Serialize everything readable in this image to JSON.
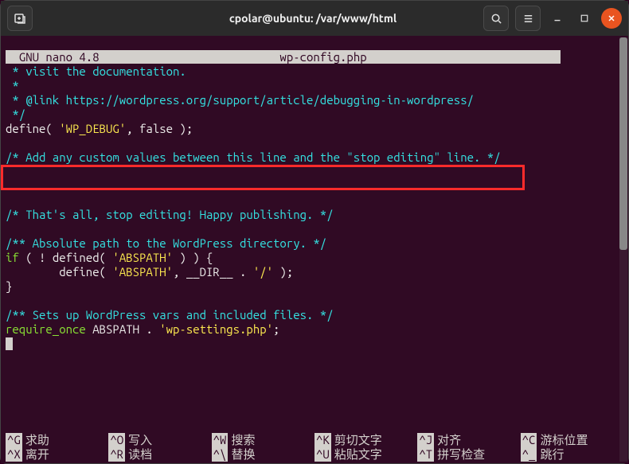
{
  "titlebar": {
    "title": "cpolar@ubuntu: /var/www/html"
  },
  "editor": {
    "header_left": "  GNU nano 4.8",
    "header_center": "wp-config.php",
    "lines": {
      "l1": " * visit the documentation.",
      "l2": " *",
      "l3": " * @link https://wordpress.org/support/article/debugging-in-wordpress/",
      "l4": " */",
      "l5a": "define( ",
      "l5b": "'WP_DEBUG'",
      "l5c": ", false );",
      "l6": "/* Add any custom values between this line and the \"stop editing\" line. */",
      "l7": "/* That's all, stop editing! Happy publishing. */",
      "l8": "/** Absolute path to the WordPress directory. */",
      "l9a": "if",
      "l9b": " ( ! defined( ",
      "l9c": "'ABSPATH'",
      "l9d": " ) ) {",
      "l10a": "        define( ",
      "l10b": "'ABSPATH'",
      "l10c": ", __DIR__ . ",
      "l10d": "'/'",
      "l10e": " );",
      "l11": "}",
      "l12": "/** Sets up WordPress vars and included files. */",
      "l13a": "require_once",
      "l13b": " ABSPATH . ",
      "l13c": "'wp-settings.php'",
      "l13d": ";"
    }
  },
  "help": {
    "r1c1k": "^G",
    "r1c1l": "求助",
    "r1c2k": "^O",
    "r1c2l": "写入",
    "r1c3k": "^W",
    "r1c3l": "搜索",
    "r1c4k": "^K",
    "r1c4l": "剪切文字",
    "r1c5k": "^J",
    "r1c5l": "对齐",
    "r1c6k": "^C",
    "r1c6l": "游标位置",
    "r2c1k": "^X",
    "r2c1l": "离开",
    "r2c2k": "^R",
    "r2c2l": "读档",
    "r2c3k": "^\\",
    "r2c3l": "替换",
    "r2c4k": "^U",
    "r2c4l": "粘贴文字",
    "r2c5k": "^T",
    "r2c5l": "拼写检查",
    "r2c6k": "^_",
    "r2c6l": "跳行"
  }
}
